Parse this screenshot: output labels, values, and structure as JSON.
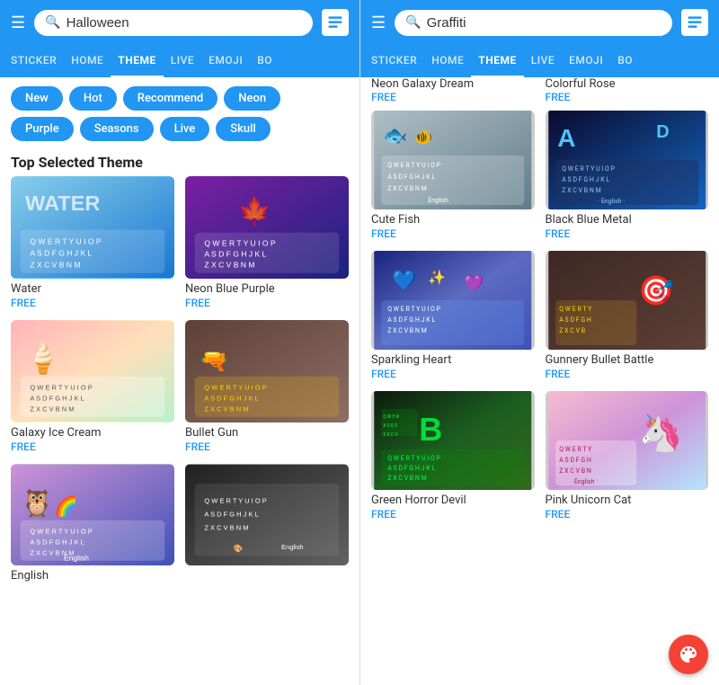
{
  "left_panel": {
    "header": {
      "search_placeholder": "Halloween",
      "hamburger_label": "☰",
      "profile_label": "profile"
    },
    "nav_tabs": [
      {
        "label": "STICKER",
        "active": false
      },
      {
        "label": "HOME",
        "active": false
      },
      {
        "label": "THEME",
        "active": true
      },
      {
        "label": "LIVE",
        "active": false
      },
      {
        "label": "EMOJI",
        "active": false
      },
      {
        "label": "BO",
        "active": false
      }
    ],
    "chips": [
      {
        "label": "New"
      },
      {
        "label": "Hot"
      },
      {
        "label": "Recommend"
      },
      {
        "label": "Neon"
      },
      {
        "label": "Purple"
      },
      {
        "label": "Seasons"
      },
      {
        "label": "Live"
      },
      {
        "label": "Skull"
      }
    ],
    "section_title": "Top Selected Theme",
    "themes": [
      {
        "name": "Water",
        "price": "FREE",
        "img_class": "img-water"
      },
      {
        "name": "Neon Blue Purple",
        "price": "FREE",
        "img_class": "img-neon"
      },
      {
        "name": "Galaxy Ice Cream",
        "price": "FREE",
        "img_class": "img-galaxy"
      },
      {
        "name": "Bullet Gun",
        "price": "FREE",
        "img_class": "img-bullet"
      },
      {
        "name": "English",
        "price": "",
        "img_class": "img-english"
      },
      {
        "name": "",
        "price": "",
        "img_class": "img-dark"
      }
    ]
  },
  "right_panel": {
    "header": {
      "search_placeholder": "Graffiti",
      "hamburger_label": "☰",
      "profile_label": "profile"
    },
    "nav_tabs": [
      {
        "label": "STICKER",
        "active": false
      },
      {
        "label": "HOME",
        "active": false
      },
      {
        "label": "THEME",
        "active": true
      },
      {
        "label": "LIVE",
        "active": false
      },
      {
        "label": "EMOJI",
        "active": false
      },
      {
        "label": "BO",
        "active": false
      }
    ],
    "top_items": [
      {
        "name": "Neon Galaxy Dream",
        "price": "FREE",
        "img_class": "img-neon-galaxy"
      },
      {
        "name": "Colorful Rose",
        "price": "FREE",
        "img_class": "img-colorful-rose"
      }
    ],
    "themes": [
      {
        "name": "Cute Fish",
        "price": "FREE",
        "img_class": "img-cute-fish"
      },
      {
        "name": "Black Blue Metal",
        "price": "FREE",
        "img_class": "img-black-metal"
      },
      {
        "name": "Sparkling Heart",
        "price": "FREE",
        "img_class": "img-sparkling"
      },
      {
        "name": "Gunnery Bullet Battle",
        "price": "FREE",
        "img_class": "img-gunnery"
      },
      {
        "name": "Green Horror Devil",
        "price": "FREE",
        "img_class": "img-green-horror"
      },
      {
        "name": "Pink Unicorn Cat",
        "price": "FREE",
        "img_class": "img-pink-unicorn"
      }
    ],
    "palette_btn_label": "🎨"
  }
}
